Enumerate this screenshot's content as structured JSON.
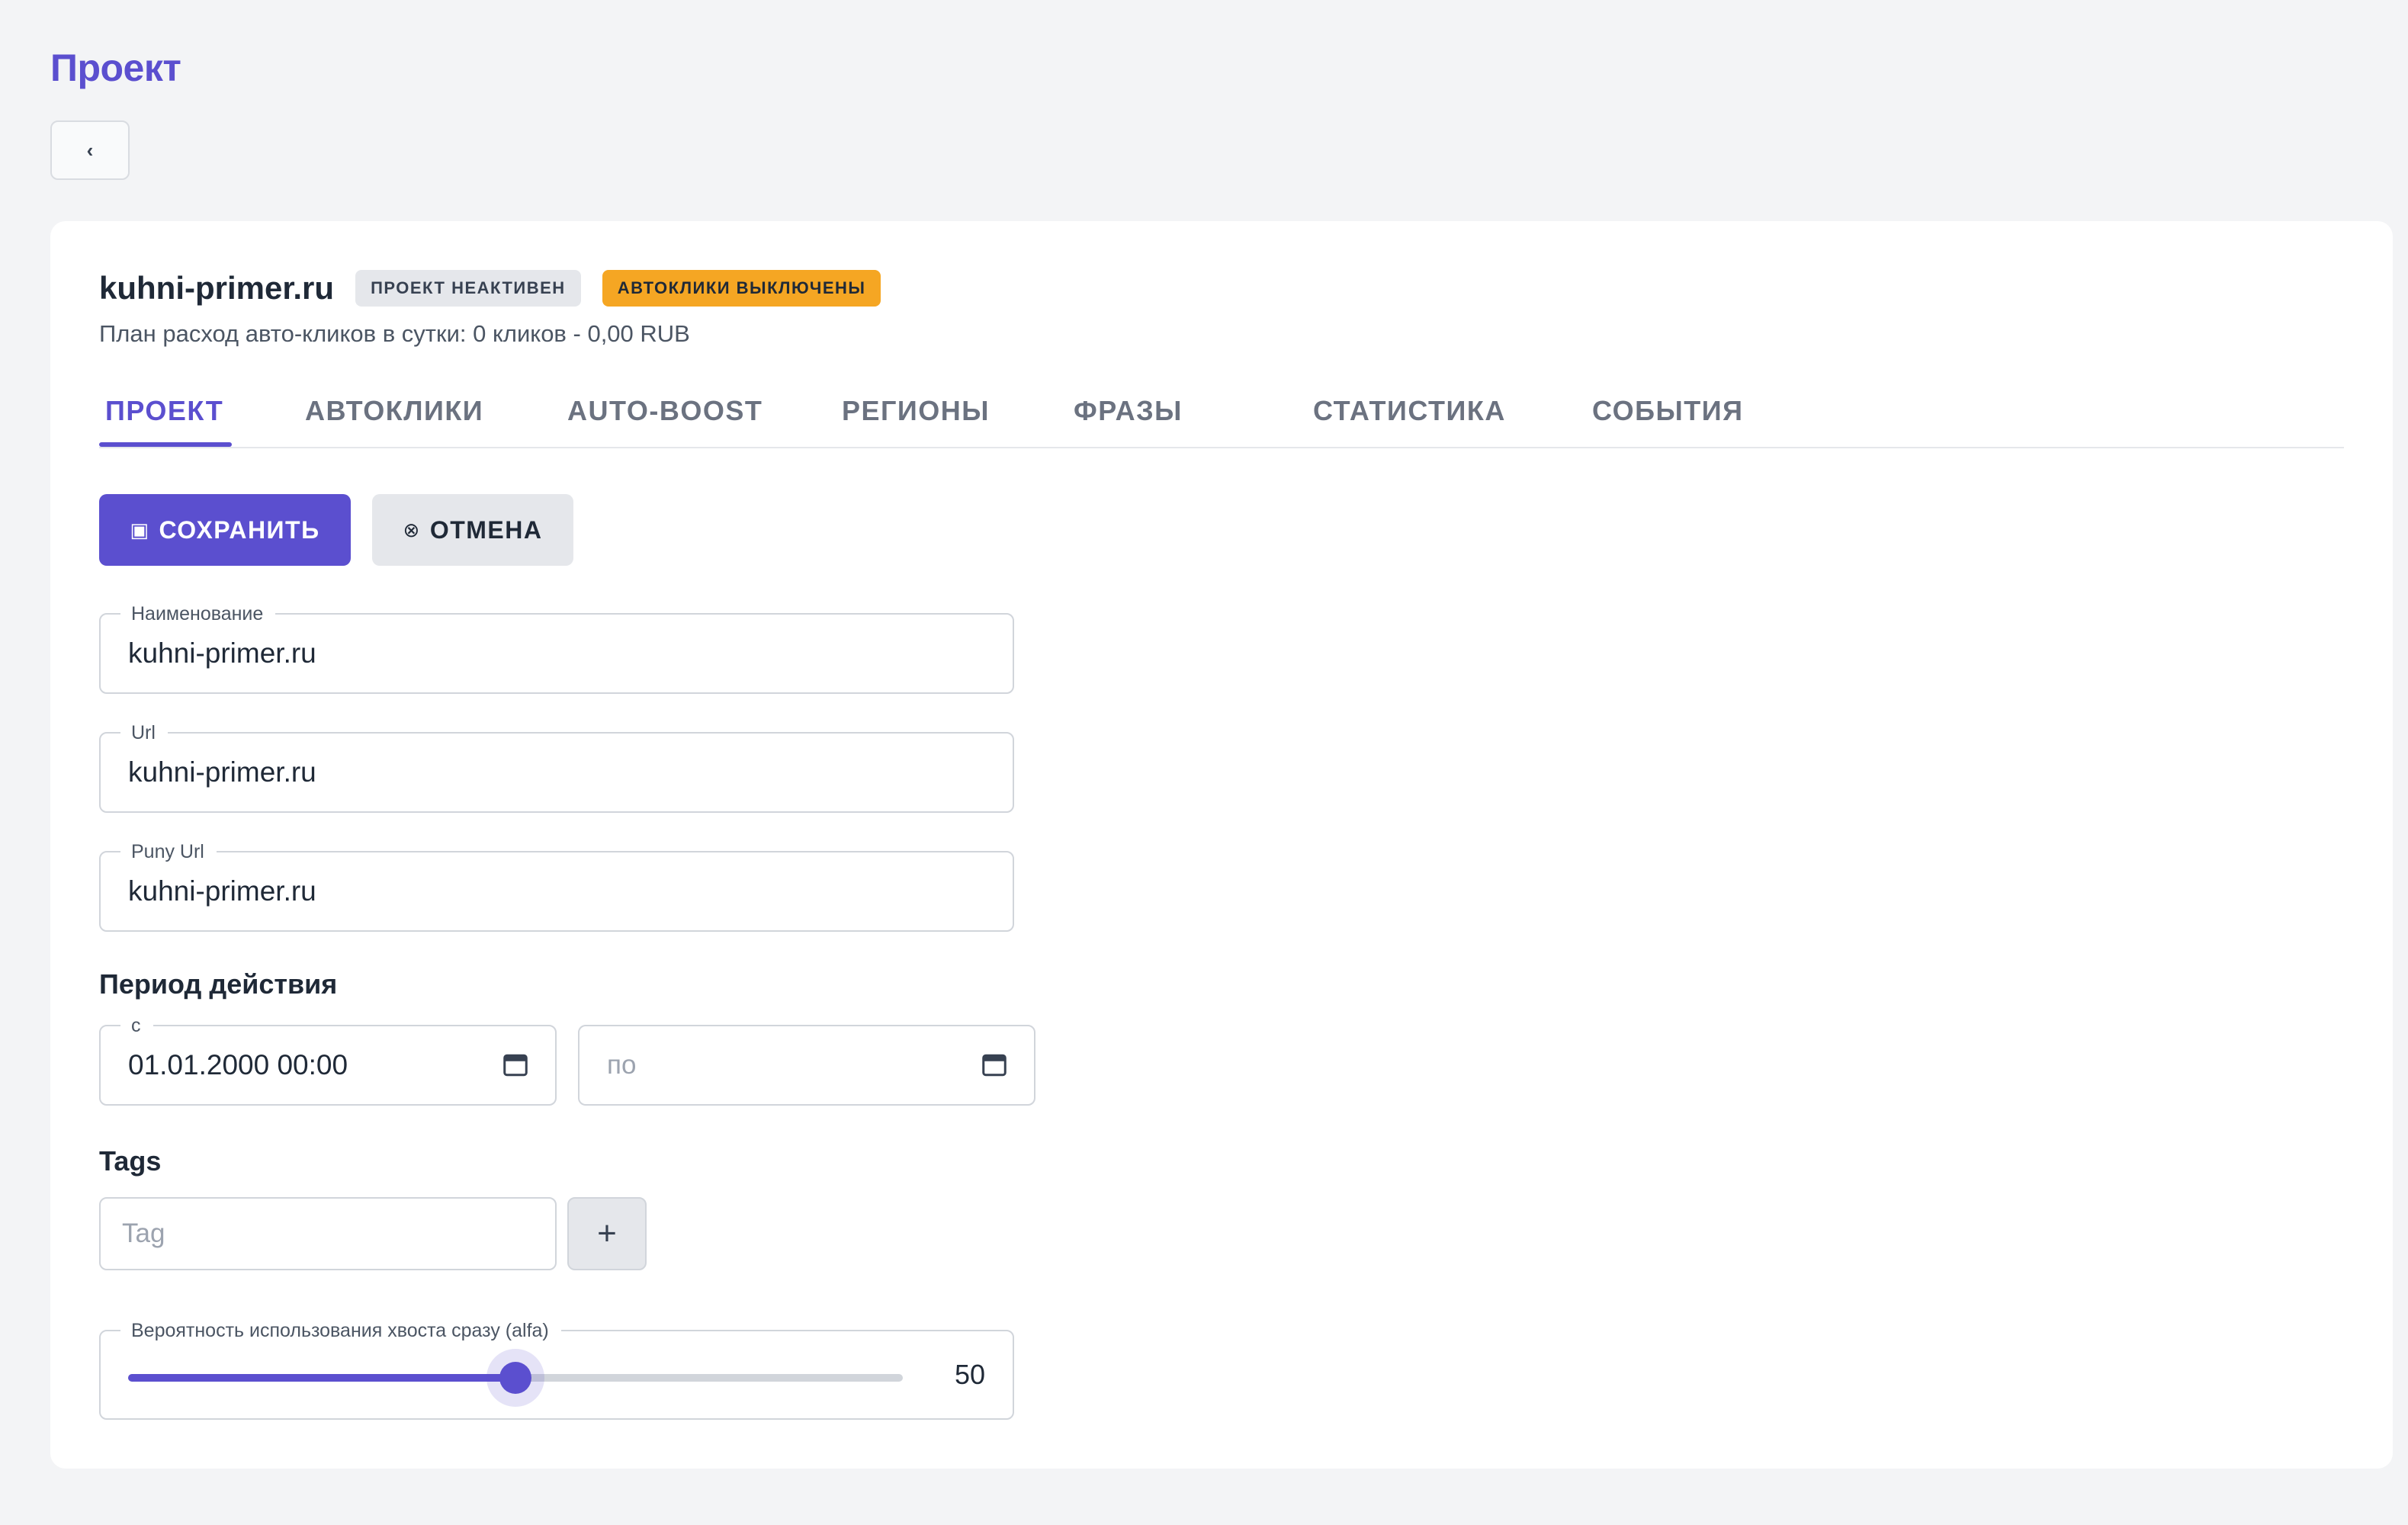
{
  "page": {
    "title": "Проект",
    "back_label": "‹"
  },
  "project": {
    "name": "kuhni-primer.ru",
    "badge_status": "ПРОЕКТ НЕАКТИВЕН",
    "badge_autoclicks": "АВТОКЛИКИ ВЫКЛЮЧЕНЫ",
    "plan_line": "План расход авто-кликов в сутки: 0 кликов - 0,00 RUB"
  },
  "tabs": [
    {
      "label": "ПРОЕКТ",
      "active": true
    },
    {
      "label": "АВТОКЛИКИ",
      "active": false
    },
    {
      "label": "AUTO-BOOST",
      "active": false
    },
    {
      "label": "РЕГИОНЫ",
      "active": false
    },
    {
      "label": "ФРАЗЫ",
      "active": false
    },
    {
      "label": "СТАТИСТИКА",
      "active": false
    },
    {
      "label": "СОБЫТИЯ",
      "active": false
    }
  ],
  "actions": {
    "save_icon": "▣",
    "save_label": "СОХРАНИТЬ",
    "cancel_icon": "⊗",
    "cancel_label": "ОТМЕНА"
  },
  "form": {
    "name": {
      "label": "Наименование",
      "value": "kuhni-primer.ru"
    },
    "url": {
      "label": "Url",
      "value": "kuhni-primer.ru"
    },
    "puny_url": {
      "label": "Puny Url",
      "value": "kuhni-primer.ru"
    },
    "period": {
      "title": "Период действия",
      "from_label": "с",
      "from_value": "01.01.2000 00:00",
      "to_placeholder": "по"
    },
    "tags": {
      "title": "Tags",
      "placeholder": "Tag",
      "add_label": "+"
    },
    "alfa": {
      "label": "Вероятность использования хвоста сразу (alfa)",
      "value": 50,
      "value_text": "50",
      "min": 0,
      "max": 100
    }
  },
  "colors": {
    "accent": "#5b4fcf",
    "warning": "#f5a623",
    "background": "#f3f4f6"
  }
}
